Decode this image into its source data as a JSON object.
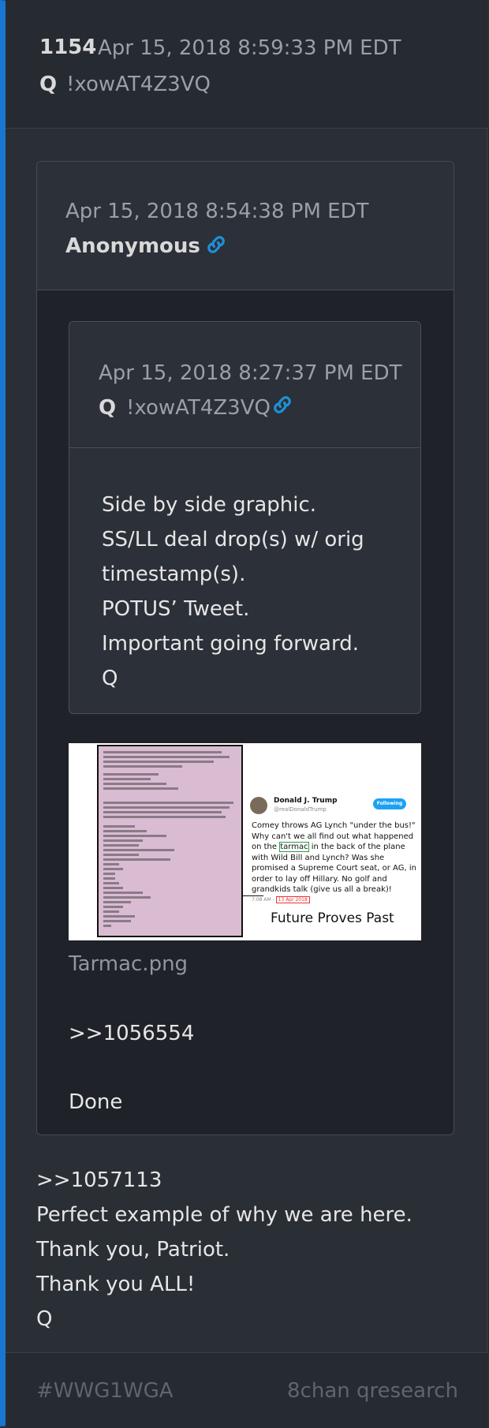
{
  "post": {
    "number": "1154",
    "timestamp": "Apr 15, 2018 8:59:33 PM EDT",
    "author": "Q",
    "tripcode": "!xowAT4Z3VQ"
  },
  "quote_outer": {
    "timestamp": "Apr 15, 2018 8:54:38 PM EDT",
    "author": "Anonymous",
    "link_icon": "link-icon",
    "quote_inner": {
      "timestamp": "Apr 15, 2018 8:27:37 PM EDT",
      "author": "Q",
      "tripcode": "!xowAT4Z3VQ",
      "link_icon": "link-icon",
      "lines": [
        "Side by side graphic.",
        "SS/LL deal drop(s) w/ orig",
        "timestamp(s).",
        "POTUS’ Tweet.",
        "Important going forward.",
        "Q"
      ]
    },
    "image": {
      "filename": "Tarmac.png",
      "tweet_author": "Donald J. Trump",
      "tweet_handle": "@realDonaldTrump",
      "tweet_follow": "Following",
      "tweet_text_pre": "Comey throws AG Lynch \"under the bus!\" Why can't we all find out what happened on the ",
      "tweet_text_highlight": "tarmac",
      "tweet_text_post": " in the back of the plane with Wild Bill and Lynch? Was she promised a Supreme Court seat, or AG, in order to lay off Hillary. No golf and grandkids talk (give us all a break)!",
      "tweet_time": "7:08 AM",
      "tweet_date": "13 Apr 2018",
      "caption": "Future Proves Past"
    },
    "reply_ref": ">>1056554",
    "done": "Done"
  },
  "body_lines": [
    ">>1057113",
    "Perfect example of why we are here.",
    "Thank you, Patriot.",
    "Thank you ALL!",
    "Q"
  ],
  "footer": {
    "tag": "#WWG1WGA",
    "source": "8chan qresearch"
  },
  "colors": {
    "accent": "#1976d2",
    "link": "#1e90d6"
  }
}
